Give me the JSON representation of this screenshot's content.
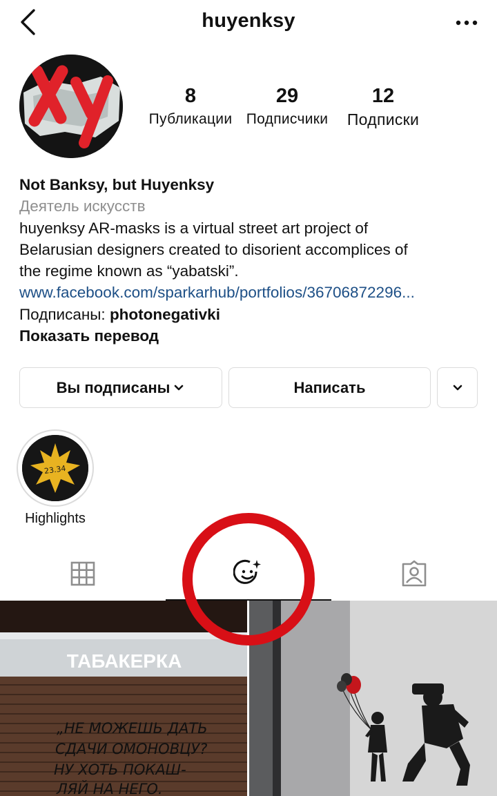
{
  "header": {
    "username": "huyenksy",
    "back_icon": "chevron-left-icon",
    "more_icon": "more-horizontal-icon"
  },
  "profile": {
    "avatar_text": "Xy",
    "stats": {
      "posts_count": "8",
      "posts_label": "Публикации",
      "followers_count": "29",
      "followers_label": "Подписчики",
      "following_count": "12",
      "following_label": "Подписки"
    }
  },
  "bio": {
    "name": "Not Banksy, but Huyenksy",
    "category": "Деятель искусств",
    "description_lines": [
      "huyenksy AR-masks is a virtual street art project of",
      "Belarusian designers created to disorient accomplices of",
      "the regime known as “yabatski”."
    ],
    "link": "www.facebook.com/sparkarhub/portfolios/36706872296...",
    "followed_by_prefix": "Подписаны: ",
    "followed_by_user": "photonegativki",
    "translate_label": "Показать перевод"
  },
  "actions": {
    "following_label": "Вы подписаны",
    "message_label": "Написать"
  },
  "highlights": [
    {
      "label": "Highlights",
      "cover_text": "23.34"
    }
  ],
  "tabs": [
    {
      "name": "grid",
      "icon": "grid-icon"
    },
    {
      "name": "effects",
      "icon": "face-sparkle-icon",
      "active": true
    },
    {
      "name": "tagged",
      "icon": "person-tag-icon"
    }
  ],
  "posts": [
    {
      "sign_text": "ТАБАКЕРКА",
      "graffiti_lines": [
        "„НЕ МОЖЕШЬ ДАТЬ",
        "СДАЧИ ОМОНОВЦУ?",
        "НУ ХОТЬ ПОКАШ-",
        "ЛЯЙ НА НЕГО."
      ]
    },
    {
      "image": "balloon-girl-and-riot-police-art"
    }
  ],
  "colors": {
    "link": "#1d4f86",
    "muted": "#8e8e8e",
    "annotation": "#d80f16",
    "border": "#dbdbdb"
  }
}
